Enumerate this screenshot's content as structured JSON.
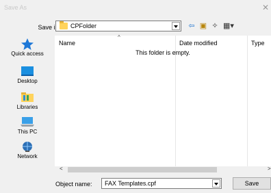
{
  "window": {
    "title": "Save As",
    "close_glyph": "✕"
  },
  "save_in": {
    "label": "Save in:",
    "value": "CPFolder"
  },
  "toolbar": [
    {
      "name": "back-icon",
      "glyph": "⇦",
      "color": "#2b7bd0"
    },
    {
      "name": "up-folder-icon",
      "glyph": "▣",
      "color": "#b8860b"
    },
    {
      "name": "new-folder-icon",
      "glyph": "✧",
      "color": "#333333"
    },
    {
      "name": "view-menu-icon",
      "glyph": "▦▾",
      "color": "#333333"
    }
  ],
  "places": [
    {
      "label": "Quick access",
      "icon": "star-icon"
    },
    {
      "label": "Desktop",
      "icon": "desktop-icon"
    },
    {
      "label": "Libraries",
      "icon": "libraries-icon"
    },
    {
      "label": "This PC",
      "icon": "computer-icon"
    },
    {
      "label": "Network",
      "icon": "network-icon"
    }
  ],
  "file_list": {
    "columns": [
      "Name",
      "Date modified",
      "Type"
    ],
    "empty_message": "This folder is empty."
  },
  "scrollbar": {
    "left_glyph": "<",
    "right_glyph": ">"
  },
  "object_name": {
    "label": "Object name:",
    "value": "FAX Templates.cpf"
  },
  "buttons": {
    "save": "Save"
  },
  "colors": {
    "star": "#1e78d7",
    "desktop": "#1a8fe0",
    "folder": "#ffd35c"
  }
}
